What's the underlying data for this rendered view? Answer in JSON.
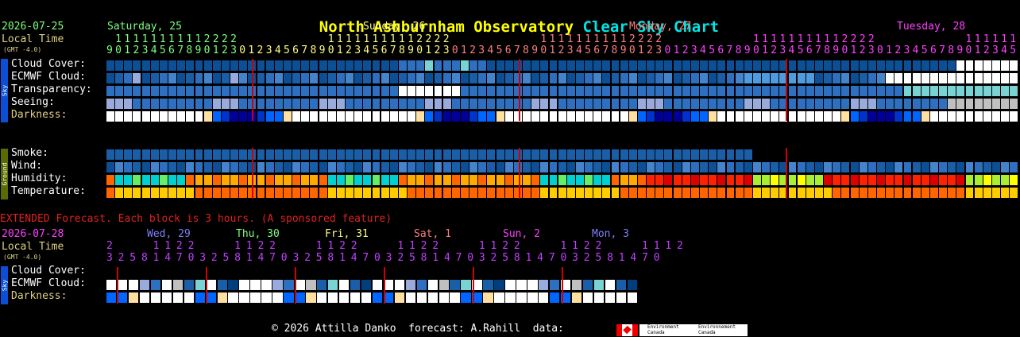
{
  "header": {
    "observatory": "North Ashburnham Observatory",
    "chart_name": "Clear Sky Chart"
  },
  "main": {
    "date": "2026-07-25",
    "local_time_label": "Local Time",
    "gmt_label": "(GMT -4.0)",
    "days": [
      {
        "label": "Saturday, 25",
        "color": "#7fff7f"
      },
      {
        "label": "Sunday, 26",
        "color": "#ffff7f"
      },
      {
        "label": "Monday, 27",
        "color": "#ff7f7f"
      },
      {
        "label": "Tuesday, 28",
        "color": "#ff40ff"
      }
    ],
    "row_labels": [
      "Cloud Cover:",
      "ECMWF Cloud:",
      "Transparency:",
      "Seeing:",
      "Darkness:"
    ],
    "sky_tab": "Sky",
    "ground_tab": "Ground",
    "ground_labels": [
      "Smoke:",
      "Wind:",
      "Humidity:",
      "Temperature:"
    ]
  },
  "extended": {
    "notice": "EXTENDED Forecast. Each block is 3 hours. (A sponsored feature)",
    "date": "2026-07-28",
    "local_time_label": "Local Time",
    "gmt_label": "(GMT -4.0)",
    "days": [
      {
        "label": "Wed, 29",
        "color": "#7f7fff"
      },
      {
        "label": "Thu, 30",
        "color": "#7fff7f"
      },
      {
        "label": "Fri, 31",
        "color": "#ffff7f"
      },
      {
        "label": "Sat, 1",
        "color": "#ff7f7f"
      },
      {
        "label": "Sun, 2",
        "color": "#ff40ff"
      },
      {
        "label": "Mon, 3",
        "color": "#7f7fff"
      }
    ],
    "hour_tens": "2       1 1 2 2       1 1 2 2       1 1 2 2       1 1 2 2       1 1 2 2       1 1 2 2       1 1 1 2",
    "hour_ones": "3 2 5 8 1 4 7 0 3 2 5 8 1 4 7 0 3 2 5 8 1 4 7 0 3 2 5 8 1 4 7 0 3 2 5 8 1 4 7 0 3 2 5 8 1 4 7 0",
    "row_labels": [
      "Cloud Cover:",
      "ECMWF Cloud:",
      "Darkness:"
    ]
  },
  "footer": {
    "copyright": "© 2026 Attilla Danko  forecast: A.Rahill  data:",
    "env_canada_1": "Environment\nCanada",
    "env_canada_2": "Environnement\nCanada"
  },
  "colors": {
    "dark_blue": "#003e7e",
    "mid_blue": "#0d5ca6",
    "light_blue": "#2e7fd0",
    "sky_tab": "#0a4fd4",
    "ground_tab": "#5a6b00"
  }
}
